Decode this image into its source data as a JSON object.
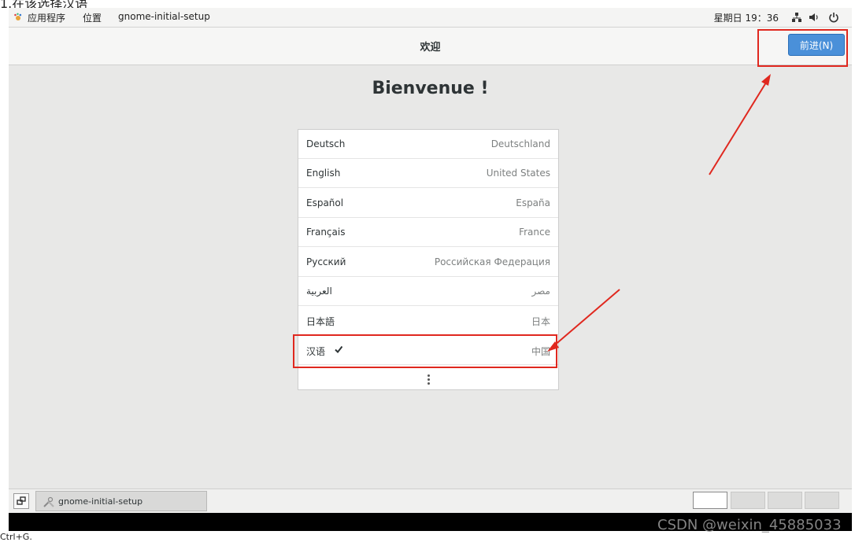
{
  "caption_cropped": "1.在该选择汉语",
  "topbar": {
    "applications": "应用程序",
    "places": "位置",
    "window_title": "gnome-initial-setup",
    "clock": "星期日 19：36"
  },
  "header": {
    "title": "欢迎",
    "next_button": "前进(N)"
  },
  "welcome_heading": "Bienvenue !",
  "languages": [
    {
      "lang": "Deutsch",
      "region": "Deutschland",
      "selected": false
    },
    {
      "lang": "English",
      "region": "United States",
      "selected": false
    },
    {
      "lang": "Español",
      "region": "España",
      "selected": false
    },
    {
      "lang": "Français",
      "region": "France",
      "selected": false
    },
    {
      "lang": "Русский",
      "region": "Российская Федерация",
      "selected": false
    },
    {
      "lang": "العربية",
      "region": "مصر",
      "selected": false
    },
    {
      "lang": "日本語",
      "region": "日本",
      "selected": false
    },
    {
      "lang": "汉语",
      "region": "中国",
      "selected": true
    }
  ],
  "taskbar": {
    "task_label": "gnome-initial-setup"
  },
  "command_hint": "Ctrl+G.",
  "watermark": "CSDN @weixin_45885033",
  "colors": {
    "accent": "#4a90d9",
    "annotation": "#e0281f"
  },
  "icons": {
    "applications": "gnome-foot-icon",
    "network": "network-icon",
    "volume": "volume-icon",
    "power": "power-icon",
    "selected": "checkmark-icon",
    "more": "vertical-ellipsis-icon"
  }
}
